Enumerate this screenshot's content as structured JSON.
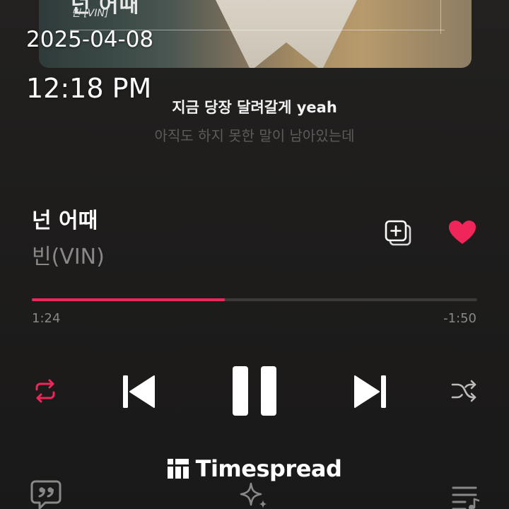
{
  "status": {
    "date": "2025-04-08",
    "time": "12:18 PM"
  },
  "album_art": {
    "title": "넌 어때",
    "artist": "빈 [VIN]"
  },
  "lyrics": {
    "current": "지금 당장 달려갈게 yeah",
    "next": "아직도 하지 못한 말이 남아있는데"
  },
  "track": {
    "title": "넌 어때",
    "artist": "빈(VIN)",
    "liked": true
  },
  "progress": {
    "elapsed": "1:24",
    "remaining": "-1:50",
    "fraction": 0.433
  },
  "controls": {
    "repeat_icon": "repeat-icon",
    "previous_icon": "skip-previous-icon",
    "pause_icon": "pause-icon",
    "next_icon": "skip-next-icon",
    "shuffle_icon": "shuffle-icon",
    "add_icon": "add-to-playlist-icon",
    "like_icon": "heart-icon",
    "lyrics_icon": "lyrics-quote-icon",
    "sparkle_icon": "sparkle-icon",
    "queue_icon": "playlist-queue-icon"
  },
  "watermark": {
    "text": "Timespread"
  },
  "colors": {
    "accent": "#f0265a",
    "background": "#1e1d1c",
    "muted_text": "#8a8887"
  }
}
